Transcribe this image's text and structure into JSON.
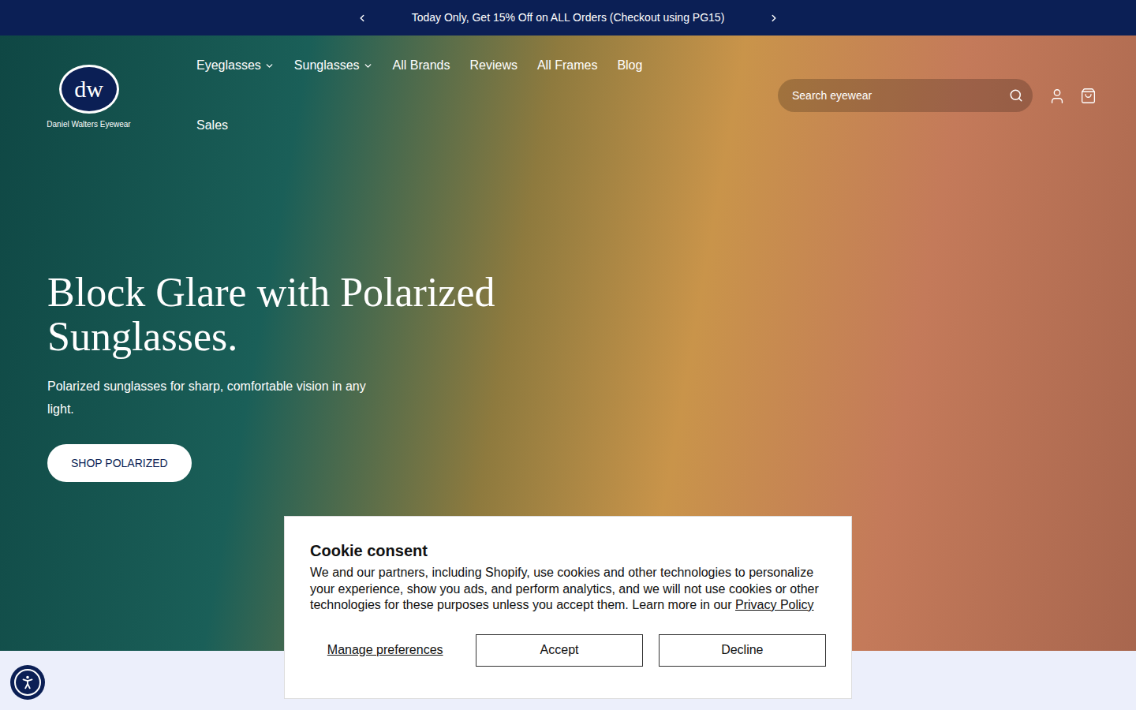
{
  "announcement": {
    "text": "Today Only, Get 15% Off on ALL Orders (Checkout using PG15)"
  },
  "logo": {
    "mark": "dw",
    "name": "Daniel Walters Eyewear"
  },
  "nav": [
    {
      "label": "Eyeglasses",
      "dropdown": true
    },
    {
      "label": "Sunglasses",
      "dropdown": true
    },
    {
      "label": "All Brands",
      "dropdown": false
    },
    {
      "label": "Reviews",
      "dropdown": false
    },
    {
      "label": "All Frames",
      "dropdown": false
    },
    {
      "label": "Blog",
      "dropdown": false
    },
    {
      "label": "Sales",
      "dropdown": false
    }
  ],
  "search": {
    "placeholder": "Search eyewear"
  },
  "hero": {
    "title": "Block Glare with Polarized Sunglasses.",
    "subtitle": "Polarized sunglasses for sharp, comfortable vision in any light.",
    "button": "SHOP POLARIZED"
  },
  "cookie": {
    "title": "Cookie consent",
    "text": "We and our partners, including Shopify, use cookies and other technologies to personalize your experience, show you ads, and perform analytics, and we will not use cookies or other technologies for these purposes unless you accept them. Learn more in our ",
    "link": "Privacy Policy",
    "buttons": [
      "Manage preferences",
      "Accept",
      "Decline"
    ]
  }
}
